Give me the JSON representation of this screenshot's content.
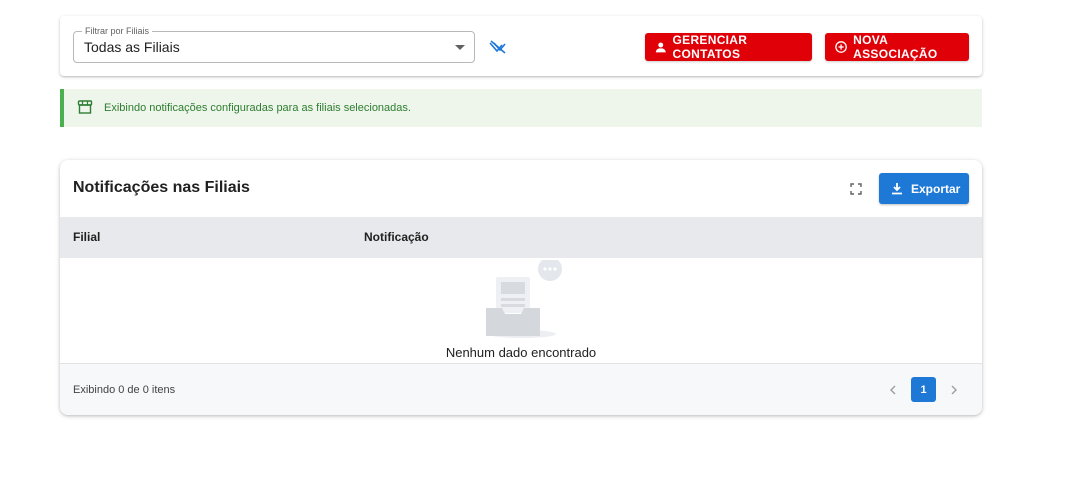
{
  "filter": {
    "legend": "Filtrar por Filiais",
    "selected": "Todas as Filiais",
    "clear_icon": "filter-off-icon"
  },
  "actions": {
    "manage_contacts_label": "GERENCIAR CONTATOS",
    "manage_contacts_icon": "person-icon",
    "new_association_label": "NOVA ASSOCIAÇÃO",
    "new_association_icon": "add-circle-icon",
    "accent_color": "#e00008"
  },
  "alert": {
    "icon": "store-icon",
    "text": "Exibindo notificações configuradas para as filiais selecionadas.",
    "color": "#2e7d32",
    "background": "#eef5ea"
  },
  "table": {
    "title": "Notificações nas Filiais",
    "fullscreen_icon": "fullscreen-icon",
    "export_label": "Exportar",
    "export_icon": "download-icon",
    "columns": [
      "Filial",
      "Notificação"
    ],
    "rows": [],
    "empty_text": "Nenhum dado encontrado",
    "empty_icon": "empty-inbox-icon",
    "footer_text": "Exibindo 0 de 0 itens",
    "pagination": {
      "current_page": "1",
      "prev_icon": "chevron-left-icon",
      "next_icon": "chevron-right-icon"
    },
    "primary_color": "#1e78d6"
  }
}
